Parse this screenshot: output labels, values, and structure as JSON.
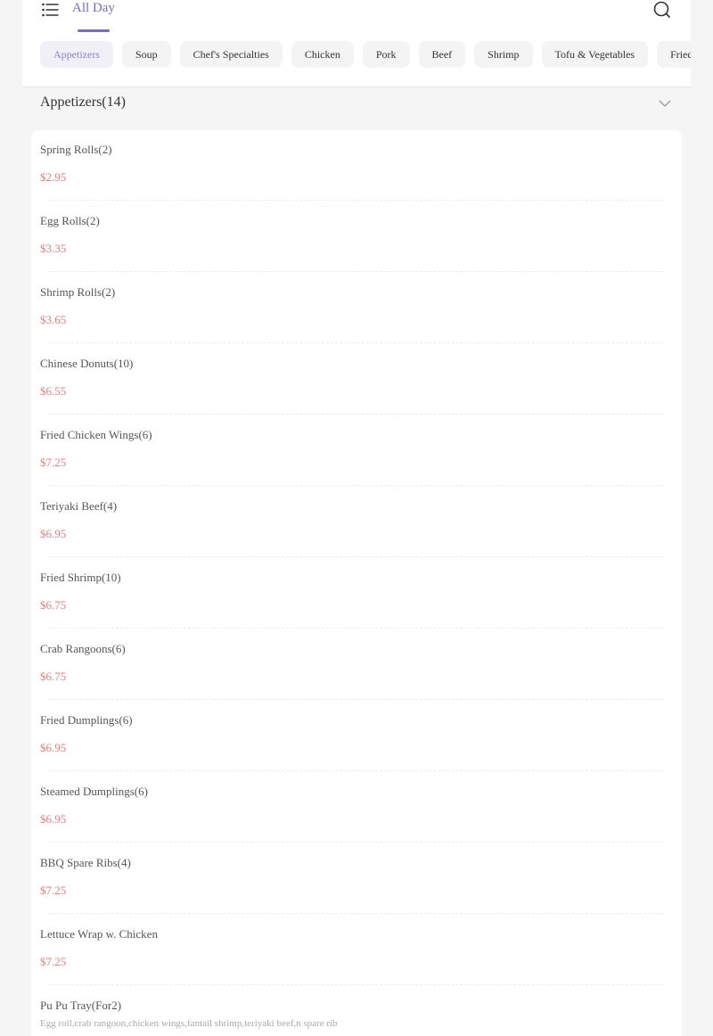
{
  "header": {
    "menu_tab": "All Day",
    "menu_icon": "hamburger-menu-icon",
    "search_icon": "search-icon",
    "accent_color": "#7b69c9"
  },
  "categories": [
    "Appetizers",
    "Soup",
    "Chef's Specialties",
    "Chicken",
    "Pork",
    "Beef",
    "Shrimp",
    "Tofu & Vegetables",
    "Fried Rice"
  ],
  "active_category": "Appetizers",
  "section": {
    "title": "Appetizers(14)",
    "chevron_icon": "chevron-down-icon"
  },
  "items": [
    {
      "name": "Spring Rolls(2)",
      "price": "$2.95"
    },
    {
      "name": "Egg Rolls(2)",
      "price": "$3.35"
    },
    {
      "name": "Shrimp Rolls(2)",
      "price": "$3.65"
    },
    {
      "name": "Chinese Donuts(10)",
      "price": "$6.55"
    },
    {
      "name": "Fried Chicken Wings(6)",
      "price": "$7.25"
    },
    {
      "name": "Teriyaki Beef(4)",
      "price": "$6.95"
    },
    {
      "name": "Fried Shrimp(10)",
      "price": "$6.75"
    },
    {
      "name": "Crab Rangoons(6)",
      "price": "$6.75"
    },
    {
      "name": "Fried Dumplings(6)",
      "price": "$6.95"
    },
    {
      "name": "Steamed Dumplings(6)",
      "price": "$6.95"
    },
    {
      "name": "BBQ Spare Ribs(4)",
      "price": "$7.25"
    },
    {
      "name": "Lettuce Wrap w. Chicken",
      "price": "$7.25"
    },
    {
      "name": "Pu Pu Tray(For2)",
      "description": "Egg roll,crab rangoon,chicken wings,fantail shrimp,teriyaki beef,n spare rib"
    }
  ],
  "colors": {
    "price": "#ef7a7a",
    "background": "#f5f5f5"
  }
}
